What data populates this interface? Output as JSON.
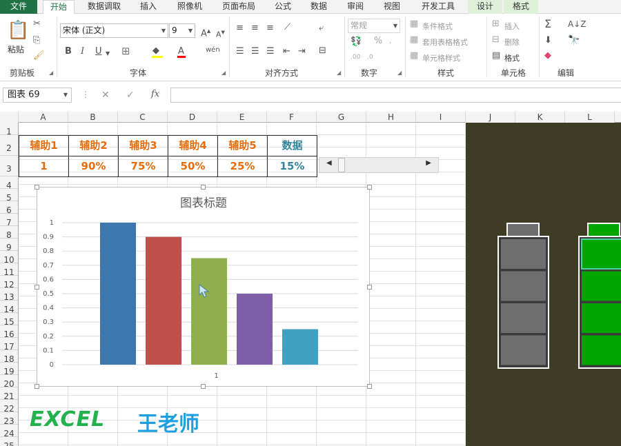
{
  "tabs": [
    {
      "label": "文件"
    },
    {
      "label": "开始"
    },
    {
      "label": "数据调取"
    },
    {
      "label": "插入"
    },
    {
      "label": "照像机"
    },
    {
      "label": "页面布局"
    },
    {
      "label": "公式"
    },
    {
      "label": "数据"
    },
    {
      "label": "审阅"
    },
    {
      "label": "视图"
    },
    {
      "label": "开发工具"
    },
    {
      "label": "设计"
    },
    {
      "label": "格式"
    }
  ],
  "ribbon": {
    "clipboard": {
      "paste": "粘贴",
      "label": "剪贴板"
    },
    "font": {
      "name": "宋体 (正文)",
      "size": "9",
      "bold": "B",
      "italic": "I",
      "underline": "U",
      "label": "字体"
    },
    "align": {
      "label": "对齐方式"
    },
    "number": {
      "format": "常规",
      "percent": "%",
      "label": "数字"
    },
    "styles": {
      "conditional": "条件格式",
      "table": "套用表格格式",
      "cell": "单元格样式",
      "label": "样式"
    },
    "cells": {
      "insert": "插入",
      "delete": "删除",
      "format": "格式",
      "label": "单元格"
    },
    "edit": {
      "label": "编辑"
    }
  },
  "formula_bar": {
    "name_box": "图表 69",
    "fx": "fx",
    "cancel": "✕",
    "confirm": "✓",
    "value": ""
  },
  "columns": [
    "A",
    "B",
    "C",
    "D",
    "E",
    "F",
    "G",
    "H",
    "I",
    "J",
    "K",
    "L"
  ],
  "rows": [
    "1",
    "2",
    "3",
    "4",
    "5",
    "6",
    "7",
    "8",
    "9",
    "10",
    "11",
    "12",
    "13",
    "14",
    "15",
    "16",
    "17",
    "18",
    "19",
    "20",
    "21",
    "22",
    "23",
    "24",
    "25"
  ],
  "table": {
    "headers": [
      "辅助1",
      "辅助2",
      "辅助3",
      "辅助4",
      "辅助5",
      "数据"
    ],
    "values": [
      "1",
      "90%",
      "75%",
      "50%",
      "25%",
      "15%"
    ],
    "header_color": "#e46c0a",
    "data_color": "#31849b"
  },
  "scrollbar": {
    "value": 0.15
  },
  "chart_data": {
    "type": "bar",
    "title": "图表标题",
    "categories": [
      "1"
    ],
    "series": [
      {
        "values": [
          1.0
        ],
        "color": "#3e77ad"
      },
      {
        "values": [
          0.9
        ],
        "color": "#c0504d"
      },
      {
        "values": [
          0.75
        ],
        "color": "#8fb04d"
      },
      {
        "values": [
          0.5
        ],
        "color": "#7f5fa8"
      },
      {
        "values": [
          0.25
        ],
        "color": "#40a0c0"
      }
    ],
    "ylim": [
      0,
      1
    ],
    "yticks": [
      "0",
      "0.1",
      "0.2",
      "0.3",
      "0.4",
      "0.5",
      "0.6",
      "0.7",
      "0.8",
      "0.9",
      "1"
    ],
    "grid": true
  },
  "batteries": [
    {
      "level": 0,
      "color": "#6e6e6e"
    },
    {
      "level": 1,
      "color": "#00a600"
    }
  ],
  "logo": {
    "excel": "EXCEL",
    "teacher": "王老师"
  }
}
